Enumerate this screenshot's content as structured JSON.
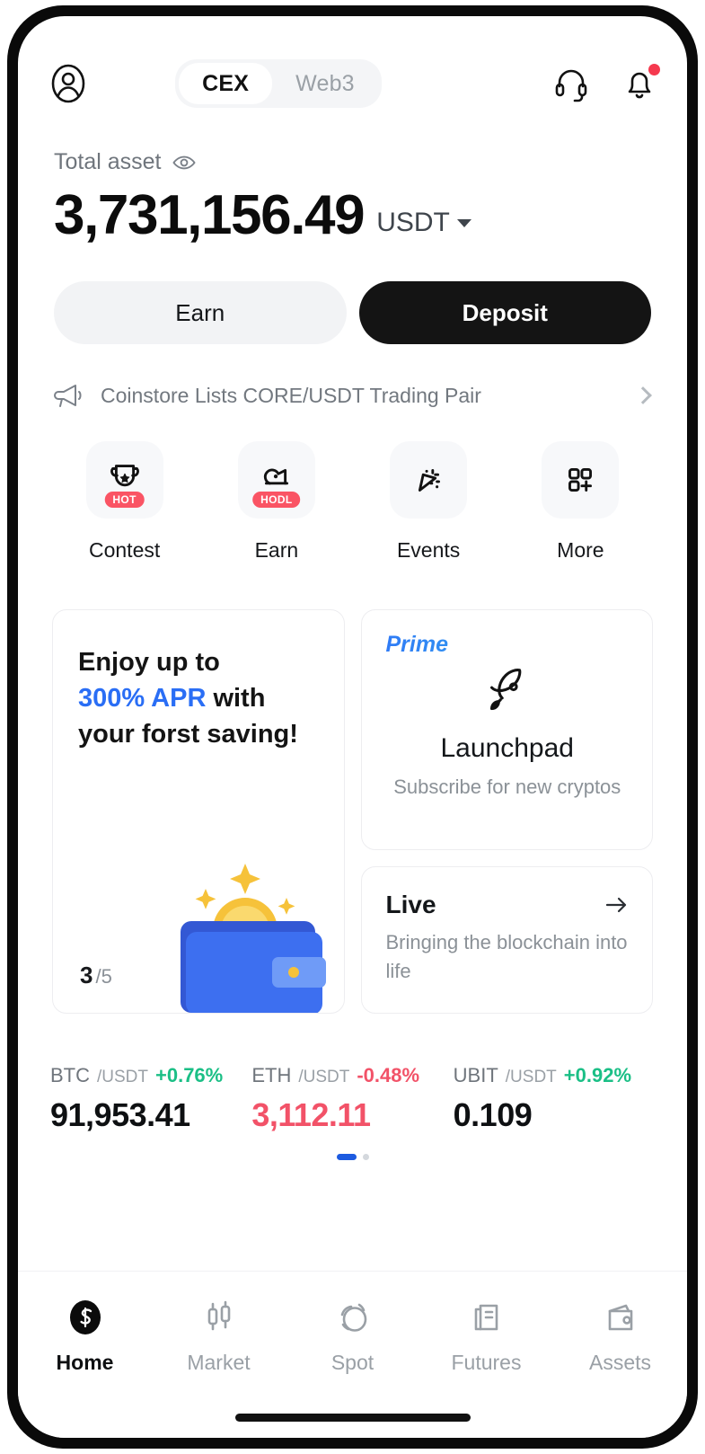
{
  "header": {
    "profile_icon": "user-circle-icon",
    "segments": [
      {
        "label": "CEX",
        "active": true
      },
      {
        "label": "Web3",
        "active": false
      }
    ],
    "support_icon": "headset-icon",
    "notification_icon": "bell-icon",
    "has_notification_badge": true
  },
  "balance": {
    "label": "Total asset",
    "eye_icon": "eye-icon",
    "amount": "3,731,156.49",
    "currency": "USDT",
    "currency_caret": "caret-down-icon"
  },
  "actions": {
    "earn_label": "Earn",
    "deposit_label": "Deposit"
  },
  "announcement": {
    "icon": "megaphone-icon",
    "text": "Coinstore Lists CORE/USDT Trading Pair",
    "chevron": "chevron-right-icon"
  },
  "quick_actions": [
    {
      "label": "Contest",
      "icon": "trophy-icon",
      "badge": "HOT"
    },
    {
      "label": "Earn",
      "icon": "piggy-coin-icon",
      "badge": "HODL"
    },
    {
      "label": "Events",
      "icon": "party-popper-icon",
      "badge": ""
    },
    {
      "label": "More",
      "icon": "grid-plus-icon",
      "badge": ""
    }
  ],
  "promo": {
    "saving_card": {
      "line1": "Enjoy up to",
      "highlight": "300% APR",
      "line2_rest": " with",
      "line3": "your forst saving!",
      "page_current": "3",
      "page_total": "/5",
      "art": "wallet-bitcoin-illustration"
    },
    "launchpad_card": {
      "tag": "Prime",
      "icon": "rocket-icon",
      "title": "Launchpad",
      "subtitle": "Subscribe for new cryptos"
    },
    "live_card": {
      "title": "Live",
      "arrow_icon": "arrow-right-icon",
      "subtitle": "Bringing the blockchain into life"
    }
  },
  "tickers": [
    {
      "base": "BTC",
      "quote": "/USDT",
      "change": "+0.76%",
      "direction": "up",
      "price": "91,953.41",
      "price_color": "neutral"
    },
    {
      "base": "ETH",
      "quote": "/USDT",
      "change": "-0.48%",
      "direction": "down",
      "price": "3,112.11",
      "price_color": "down"
    },
    {
      "base": "UBIT",
      "quote": "/USDT",
      "change": "+0.92%",
      "direction": "up",
      "price": "0.109",
      "price_color": "neutral"
    }
  ],
  "carousel": {
    "total_dots": 2,
    "active_index": 0
  },
  "bottom_nav": [
    {
      "label": "Home",
      "icon": "coinstore-logo-icon",
      "active": true
    },
    {
      "label": "Market",
      "icon": "candlestick-icon",
      "active": false
    },
    {
      "label": "Spot",
      "icon": "swap-circles-icon",
      "active": false
    },
    {
      "label": "Futures",
      "icon": "document-chart-icon",
      "active": false
    },
    {
      "label": "Assets",
      "icon": "wallet-icon",
      "active": false
    }
  ],
  "colors": {
    "accent_blue": "#2a6ef5",
    "up_green": "#1bbf86",
    "down_red": "#f25268",
    "badge_red": "#fa5464",
    "black": "#141414"
  }
}
